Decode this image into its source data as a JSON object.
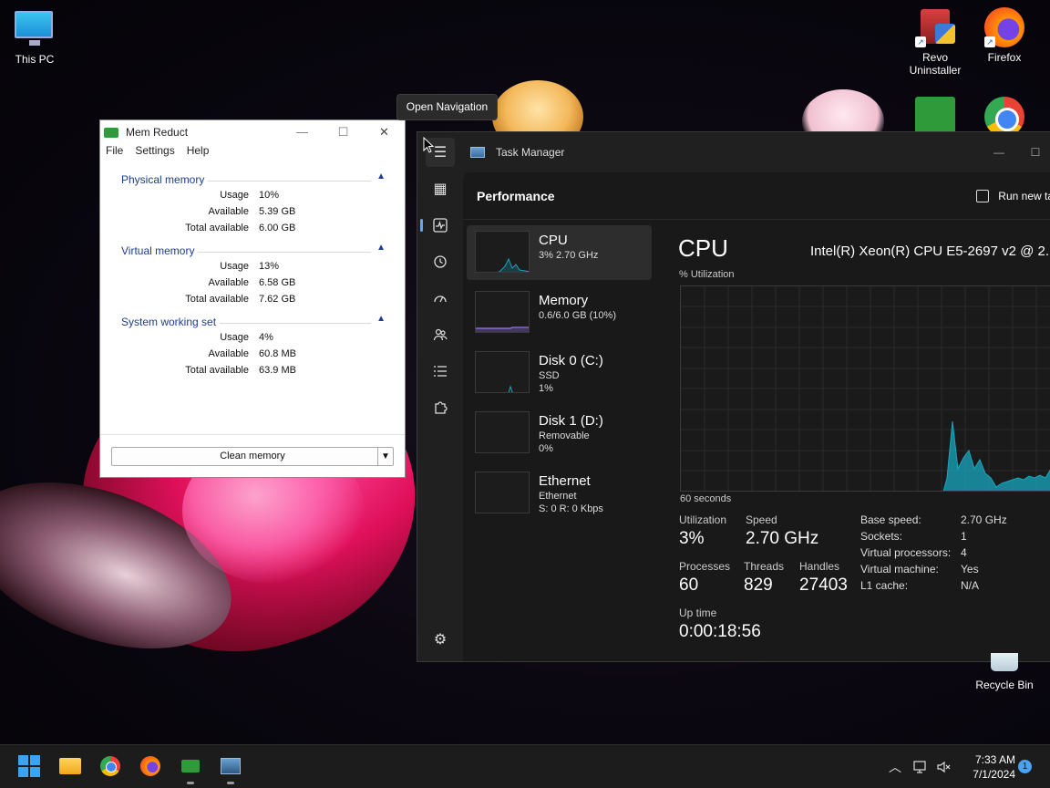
{
  "desktop": {
    "icons": {
      "this_pc": "This PC",
      "revo_line1": "Revo",
      "revo_line2": "Uninstaller",
      "firefox": "Firefox",
      "recycle_bin": "Recycle Bin"
    }
  },
  "tooltip": "Open Navigation",
  "mem_reduct": {
    "title": "Mem Reduct",
    "menu": [
      "File",
      "Settings",
      "Help"
    ],
    "groups": [
      {
        "title": "Physical memory",
        "rows": [
          {
            "k": "Usage",
            "v": "10%"
          },
          {
            "k": "Available",
            "v": "5.39 GB"
          },
          {
            "k": "Total available",
            "v": "6.00 GB"
          }
        ]
      },
      {
        "title": "Virtual memory",
        "rows": [
          {
            "k": "Usage",
            "v": "13%"
          },
          {
            "k": "Available",
            "v": "6.58 GB"
          },
          {
            "k": "Total available",
            "v": "7.62 GB"
          }
        ]
      },
      {
        "title": "System working set",
        "rows": [
          {
            "k": "Usage",
            "v": "4%"
          },
          {
            "k": "Available",
            "v": "60.8 MB"
          },
          {
            "k": "Total available",
            "v": "63.9 MB"
          }
        ]
      }
    ],
    "clean_button": "Clean memory"
  },
  "task_manager": {
    "title": "Task Manager",
    "page_title": "Performance",
    "run_new_task": "Run new tas",
    "resources": [
      {
        "name": "CPU",
        "sub": "3% 2.70 GHz",
        "sub2": ""
      },
      {
        "name": "Memory",
        "sub": "0.6/6.0 GB (10%)",
        "sub2": ""
      },
      {
        "name": "Disk 0 (C:)",
        "sub": "SSD",
        "sub2": "1%"
      },
      {
        "name": "Disk 1 (D:)",
        "sub": "Removable",
        "sub2": "0%"
      },
      {
        "name": "Ethernet",
        "sub": "Ethernet",
        "sub2": "S: 0 R: 0 Kbps"
      }
    ],
    "detail": {
      "heading": "CPU",
      "cpu_model": "Intel(R) Xeon(R) CPU E5-2697 v2 @ 2.",
      "graph_label": "% Utilization",
      "time_label": "60 seconds",
      "utilization_label": "Utilization",
      "utilization": "3%",
      "speed_label": "Speed",
      "speed": "2.70 GHz",
      "processes_label": "Processes",
      "processes": "60",
      "threads_label": "Threads",
      "threads": "829",
      "handles_label": "Handles",
      "handles": "27403",
      "uptime_label": "Up time",
      "uptime": "0:00:18:56",
      "specs": [
        {
          "k": "Base speed:",
          "v": "2.70 GHz"
        },
        {
          "k": "Sockets:",
          "v": "1"
        },
        {
          "k": "Virtual processors:",
          "v": "4"
        },
        {
          "k": "Virtual machine:",
          "v": "Yes"
        },
        {
          "k": "L1 cache:",
          "v": "N/A"
        }
      ]
    }
  },
  "taskbar": {
    "time": "7:33 AM",
    "date": "7/1/2024",
    "notification_count": "1"
  },
  "colors": {
    "accent": "#60a5fa",
    "cpu_graph": "#17a7bf",
    "memory_graph": "#8a6cd8",
    "ethernet_graph": "#d4605a"
  }
}
